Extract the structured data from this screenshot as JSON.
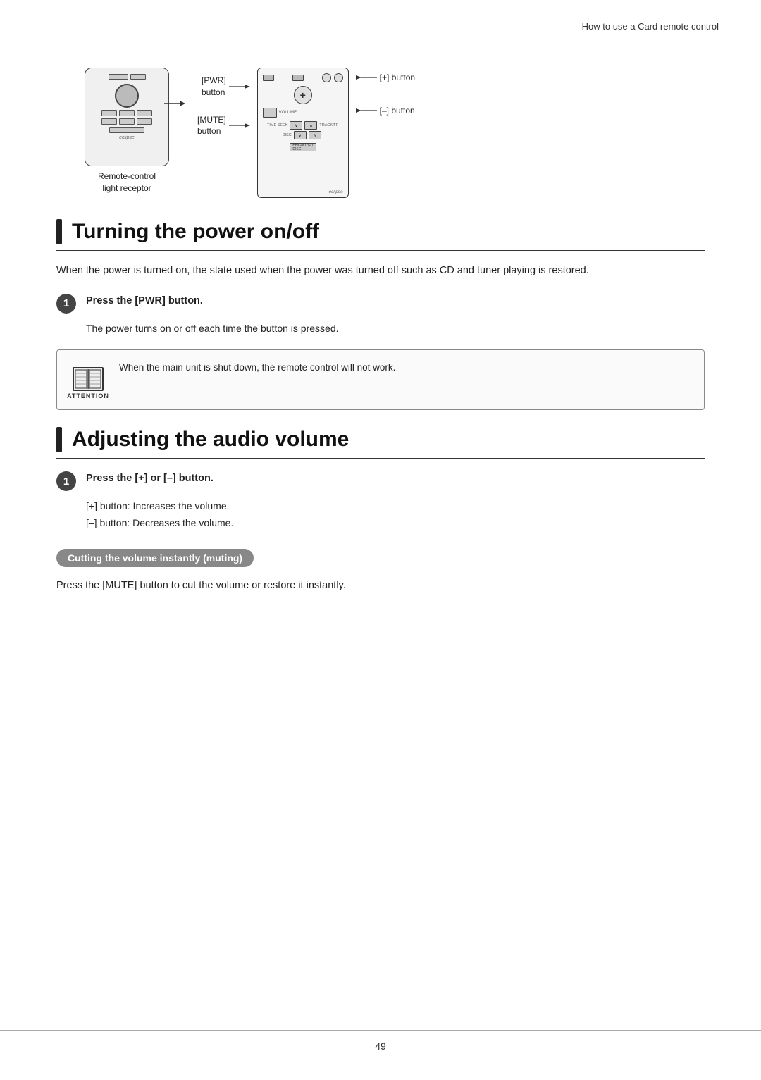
{
  "header": {
    "title": "How to use a Card remote control",
    "separator": true
  },
  "diagram": {
    "left_device": {
      "label_line1": "Remote-control",
      "label_line2": "light receptor"
    },
    "card_labels_left": [
      {
        "text": "[PWR]\nbutton"
      },
      {
        "text": "[MUTE]\nbutton"
      }
    ],
    "card_labels_right": [
      {
        "text": "[+] button"
      },
      {
        "text": "[–] button"
      }
    ]
  },
  "sections": [
    {
      "id": "power",
      "title": "Turning the power on/off",
      "body": "When the power is turned on, the state used when the power was turned off such as CD and tuner playing is restored.",
      "steps": [
        {
          "number": "1",
          "instruction": "Press the [PWR] button.",
          "sub_text": "The power turns on or off each time the button is pressed."
        }
      ],
      "attention": {
        "label": "ATTENTION",
        "text": "When the main unit is shut down, the remote control will not work."
      }
    },
    {
      "id": "volume",
      "title": "Adjusting the audio volume",
      "steps": [
        {
          "number": "1",
          "instruction": "Press the [+] or [–] button.",
          "sub_texts": [
            "[+] button:  Increases the volume.",
            "[–] button:  Decreases the volume."
          ]
        }
      ],
      "subsection": {
        "label": "Cutting the volume instantly (muting)",
        "body": "Press the [MUTE] button to cut the volume or restore it instantly."
      }
    }
  ],
  "footer": {
    "page_number": "49"
  }
}
